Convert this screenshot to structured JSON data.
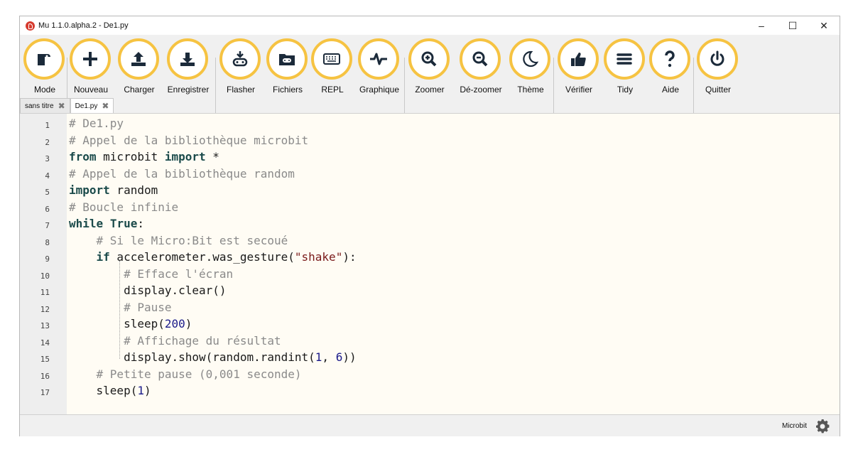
{
  "window": {
    "title": "Mu 1.1.0.alpha.2 - De1.py"
  },
  "toolbar": {
    "items": [
      {
        "label": "Mode",
        "icon": "mode-icon"
      },
      {
        "label": "Nouveau",
        "icon": "plus-icon"
      },
      {
        "label": "Charger",
        "icon": "upload-icon"
      },
      {
        "label": "Enregistrer",
        "icon": "download-icon"
      },
      {
        "label": "Flasher",
        "icon": "flash-icon"
      },
      {
        "label": "Fichiers",
        "icon": "files-icon"
      },
      {
        "label": "REPL",
        "icon": "keyboard-icon"
      },
      {
        "label": "Graphique",
        "icon": "plotter-icon"
      },
      {
        "label": "Zoomer",
        "icon": "zoom-in-icon"
      },
      {
        "label": "Dé-zoomer",
        "icon": "zoom-out-icon"
      },
      {
        "label": "Thème",
        "icon": "moon-icon"
      },
      {
        "label": "Vérifier",
        "icon": "thumbs-up-icon"
      },
      {
        "label": "Tidy",
        "icon": "tidy-icon"
      },
      {
        "label": "Aide",
        "icon": "help-icon"
      },
      {
        "label": "Quitter",
        "icon": "power-icon"
      }
    ]
  },
  "tabs": [
    {
      "label": "sans titre",
      "active": false
    },
    {
      "label": "De1.py",
      "active": true
    }
  ],
  "editor": {
    "line_numbers": [
      "1",
      "2",
      "3",
      "4",
      "5",
      "6",
      "7",
      "8",
      "9",
      "10",
      "11",
      "12",
      "13",
      "14",
      "15",
      "16",
      "17"
    ],
    "lines": [
      [
        {
          "t": "# De1.py",
          "c": "comment"
        }
      ],
      [
        {
          "t": "# Appel de la bibliothèque microbit",
          "c": "comment"
        }
      ],
      [
        {
          "t": "from",
          "c": "kw"
        },
        {
          "t": " microbit ",
          "c": ""
        },
        {
          "t": "import",
          "c": "kw"
        },
        {
          "t": " *",
          "c": ""
        }
      ],
      [
        {
          "t": "# Appel de la bibliothèque random",
          "c": "comment"
        }
      ],
      [
        {
          "t": "import",
          "c": "kw"
        },
        {
          "t": " random",
          "c": ""
        }
      ],
      [
        {
          "t": "# Boucle infinie",
          "c": "comment"
        }
      ],
      [
        {
          "t": "while",
          "c": "kw"
        },
        {
          "t": " ",
          "c": ""
        },
        {
          "t": "True",
          "c": "kw"
        },
        {
          "t": ":",
          "c": ""
        }
      ],
      [
        {
          "t": "    ",
          "c": ""
        },
        {
          "t": "# Si le Micro:Bit est secoué",
          "c": "comment"
        }
      ],
      [
        {
          "t": "    ",
          "c": ""
        },
        {
          "t": "if",
          "c": "kw"
        },
        {
          "t": " accelerometer.was_gesture(",
          "c": ""
        },
        {
          "t": "\"shake\"",
          "c": "str"
        },
        {
          "t": "):",
          "c": ""
        }
      ],
      [
        {
          "t": "        ",
          "c": ""
        },
        {
          "t": "# Efface l'écran",
          "c": "comment"
        }
      ],
      [
        {
          "t": "        display.clear()",
          "c": ""
        }
      ],
      [
        {
          "t": "        ",
          "c": ""
        },
        {
          "t": "# Pause",
          "c": "comment"
        }
      ],
      [
        {
          "t": "        sleep(",
          "c": ""
        },
        {
          "t": "200",
          "c": "num"
        },
        {
          "t": ")",
          "c": ""
        }
      ],
      [
        {
          "t": "        ",
          "c": ""
        },
        {
          "t": "# Affichage du résultat",
          "c": "comment"
        }
      ],
      [
        {
          "t": "        display.show(random.randint(",
          "c": ""
        },
        {
          "t": "1",
          "c": "num"
        },
        {
          "t": ", ",
          "c": ""
        },
        {
          "t": "6",
          "c": "num"
        },
        {
          "t": "))",
          "c": ""
        }
      ],
      [
        {
          "t": "    ",
          "c": ""
        },
        {
          "t": "# Petite pause (0,001 seconde)",
          "c": "comment"
        }
      ],
      [
        {
          "t": "    sleep(",
          "c": ""
        },
        {
          "t": "1",
          "c": "num"
        },
        {
          "t": ")",
          "c": ""
        }
      ]
    ]
  },
  "status": {
    "mode": "Microbit",
    "settings_icon": "gear-icon"
  },
  "colors": {
    "accent": "#f6c342",
    "icon_fill": "#1b2a3a",
    "editor_bg": "#fffcf4"
  }
}
